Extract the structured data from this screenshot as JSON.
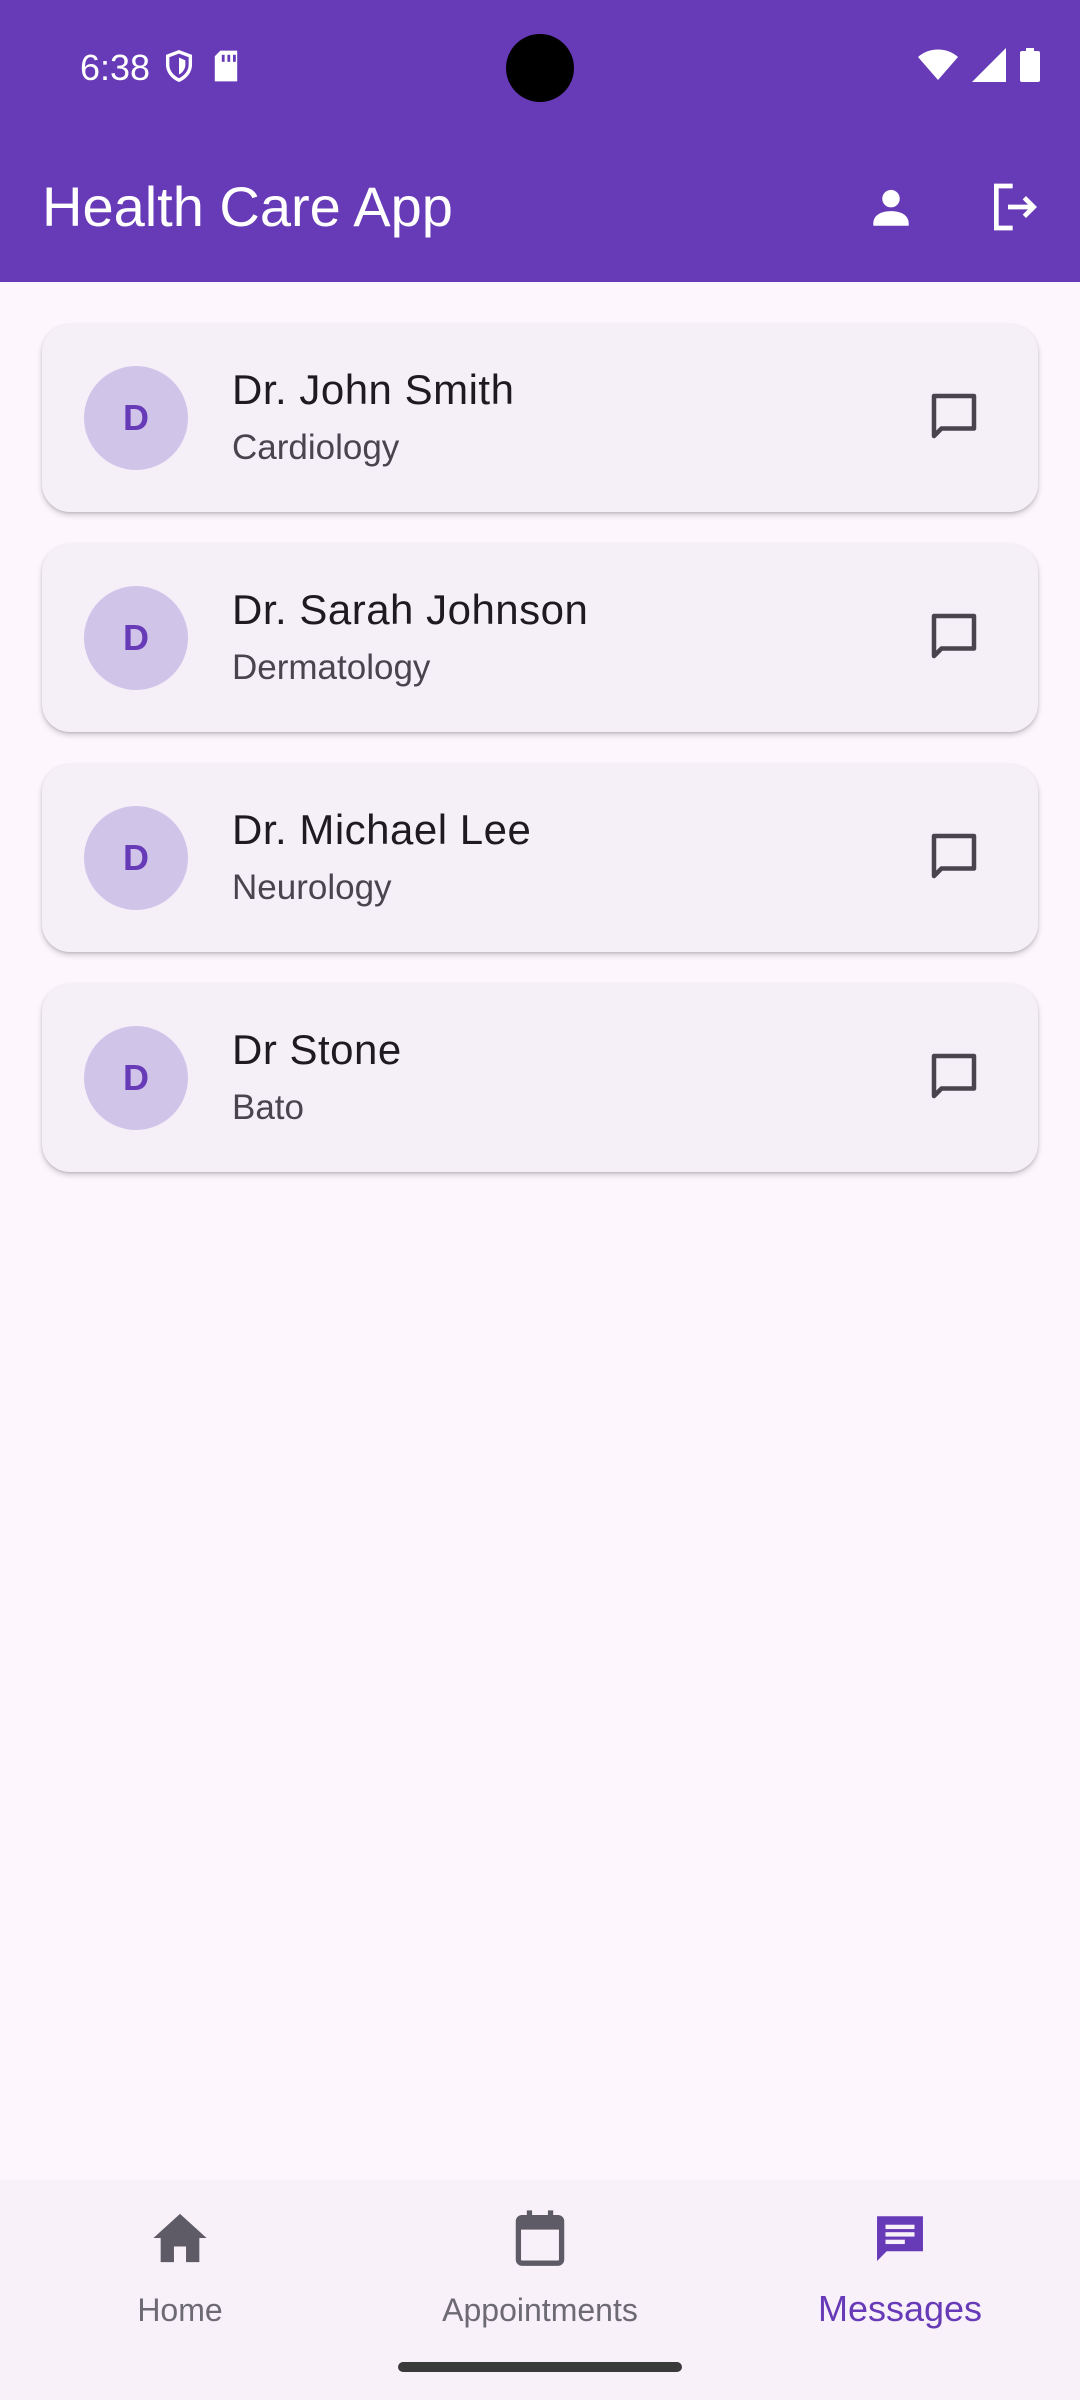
{
  "status_bar": {
    "time": "6:38",
    "icons": [
      "shield-icon",
      "sd-card-icon",
      "wifi-icon",
      "signal-icon",
      "battery-icon"
    ]
  },
  "app_bar": {
    "title": "Health Care App",
    "actions": [
      "profile-icon",
      "logout-icon"
    ]
  },
  "doctors": [
    {
      "initial": "D",
      "name": "Dr. John Smith",
      "specialty": "Cardiology"
    },
    {
      "initial": "D",
      "name": "Dr. Sarah Johnson",
      "specialty": "Dermatology"
    },
    {
      "initial": "D",
      "name": "Dr. Michael Lee",
      "specialty": "Neurology"
    },
    {
      "initial": "D",
      "name": "Dr Stone",
      "specialty": "Bato"
    }
  ],
  "bottom_nav": {
    "items": [
      {
        "label": "Home",
        "icon": "home-icon",
        "active": false
      },
      {
        "label": "Appointments",
        "icon": "calendar-icon",
        "active": false
      },
      {
        "label": "Messages",
        "icon": "message-icon",
        "active": true
      }
    ]
  },
  "colors": {
    "primary": "#673ab7",
    "background": "#fdf7fd",
    "card": "#f5eff7",
    "avatar_bg": "#d1c4e9"
  }
}
